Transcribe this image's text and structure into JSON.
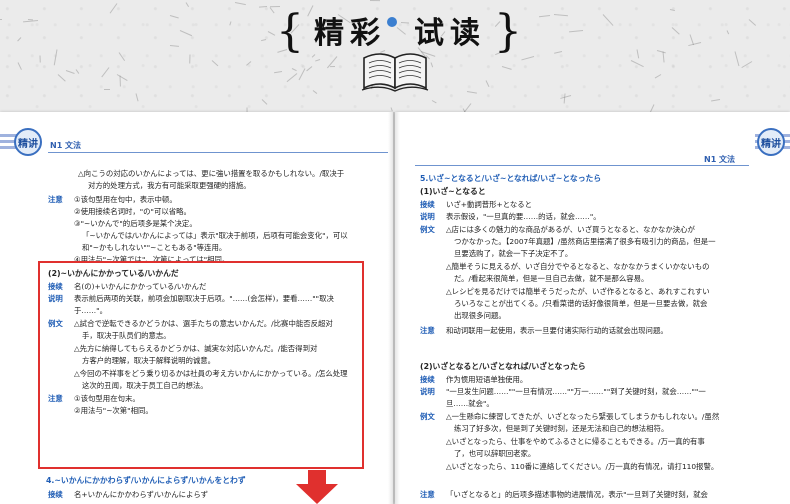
{
  "banner": {
    "brace_left": "{",
    "brace_right": "}",
    "title_part1": "精彩",
    "title_part2": "试读",
    "accent_color": "#3b7fd0",
    "icon": "open-book-icon"
  },
  "left_page": {
    "badge": "精讲",
    "header": "N1 文法",
    "lines": [
      "△向こうの対応のいかんによっては、更に強い措置を取るかもしれない。/取决于",
      "对方的处理方式，我方有可能采取更强硬的措施。",
      "①该句型用在句中，表示中顿。",
      "②使用接续名词时，\"の\"可以省略。",
      "③\"~いかんで\"的后项多是某个决定。",
      "「~いかんでは/いかんによっては」表示\"取决于前项，后项有可能会变化\"，可以",
      "和\"~かもしれない\"\"~こともある\"等连用。",
      "④用法与\"~次第では\"、次第によっては\"相同。",
      "名(の)+いかんにかかっている/いかんだ",
      "表示前后两项的关联，前项会加剧取决于后项。\"……(会怎样)，要看……\"\"取决",
      "于……\"。",
      "△試合で逆転できるかどうかは、選手たちの意志いかんだ。/比赛中能否反超对",
      "手，取决于队员们的意志。",
      "△先方に納得してもらえるかどうかは、誠実な対応いかんだ。/能否得到对",
      "方客户的理解，取决于解释说明的诚意。",
      "△今回の不祥事をどう乗り切るかは社員の考え方いかんにかかっている。/怎么处理",
      "这次的丑闻，取决于员工自己的想法。",
      "①该句型用在句末。",
      "②用法与\"~次第\"相同。",
      "名+いかんにかかわらず/いかんによらず"
    ],
    "labels": [
      "注意",
      "接续",
      "说明",
      "例文",
      "注意",
      "接续"
    ],
    "headings": {
      "sub2": "(2)~いかんにかかっている/いかんだ",
      "section4": "4.~いかんにかかわらず/いかんによらず/いかんをとわず"
    },
    "frame_color": "#e0302e"
  },
  "right_page": {
    "badge": "精讲",
    "header": "N1 文法",
    "headings": {
      "section5": "5.いざ~となると/いざ~となれば/いざ~となったら",
      "sub1": "(1)いざ~となると",
      "sub2": "(2)いざとなると/いざとなれば/いざとなったら"
    },
    "labels": [
      "接续",
      "说明",
      "例文",
      "注意",
      "接续",
      "说明",
      "例文",
      "注意"
    ],
    "lines": [
      "いざ+動詞普形+となると",
      "表示假设，\"一旦真的要……的话，就会……\"。",
      "△店には多くの魅力的な商品があるが、いざ買うとなると、なかなか決心が",
      "つかなかった。【2007年真题】/虽然商店里摆满了很多有吸引力的商品，但是一",
      "旦要选购了，就会一下子决定不了。",
      "△簡単そうに見えるが、いざ自分でやるとなると、なかなかうまくいかないもの",
      "だ。/看起来很简单，但是一旦自己去做，就不是那么容易。",
      "△レシピを見るだけでは簡単そうだったが、いざ作るとなると、あれすこれすい",
      "ろいろなことが出てくる。/只看菜谱的话好像很简单，但是一旦要去做，就会",
      "出现很多问题。",
      "和动词联用一起使用，表示一旦要付诸实际行动的话就会出现问题。",
      "作为惯用短语单独使用。",
      "\"一旦发生问题……\"\"一旦有情况……\"\"万一……\"\"到了关键时刻，就会……\"\"一",
      "旦……就会\"。",
      "△一生懸命に練習してきたが、いざとなったら緊張してしまうかもしれない。/虽然",
      "练习了好多次，但是到了关键时刻，还是无法和自己的想法相符。",
      "△いざとなったら、仕事をやめてふるさとに帰ることもできる。/万一真的有事",
      "了，也可以辞职回老家。",
      "△いざとなったら、110番に連絡してください。/万一真的有情况，请打110报警。",
      "「いざとなると」的后项多描述事物的进展情况，表示\"一旦到了关键时刻，就会"
    ]
  }
}
